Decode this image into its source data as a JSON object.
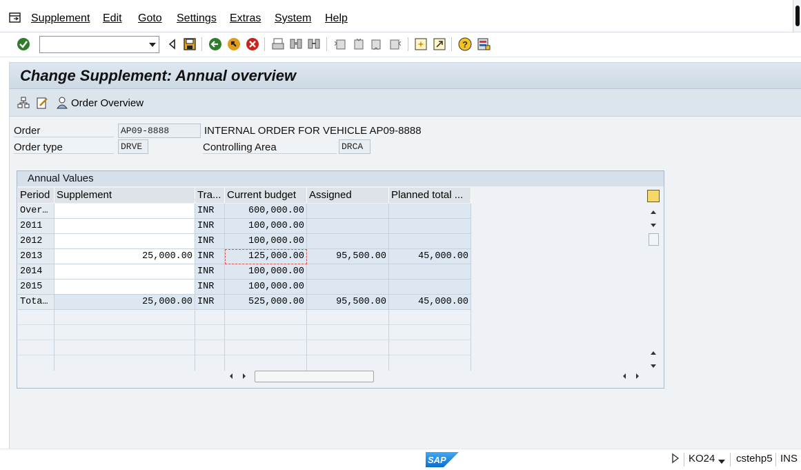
{
  "menu": {
    "items": [
      "Supplement",
      "Edit",
      "Goto",
      "Settings",
      "Extras",
      "System",
      "Help"
    ]
  },
  "toolbar": {
    "command_value": "",
    "icons": [
      "enter-icon",
      "back-icon",
      "save-icon",
      "green-back-icon",
      "exit-icon",
      "cancel-icon",
      "print-icon",
      "find-icon",
      "find-next-icon",
      "first-page-icon",
      "previous-page-icon",
      "next-page-icon",
      "last-page-icon",
      "create-session-icon",
      "shortcut-icon",
      "help-icon",
      "customize-layout-icon"
    ]
  },
  "title": "Change Supplement: Annual overview",
  "app_toolbar": {
    "order_overview_label": "Order Overview"
  },
  "header": {
    "order_label": "Order",
    "order_value": "AP09-8888",
    "order_description": "INTERNAL ORDER FOR VEHICLE AP09-8888",
    "order_type_label": "Order type",
    "order_type_value": "DRVE",
    "controlling_area_label": "Controlling Area",
    "controlling_area_value": "DRCA"
  },
  "annual_values": {
    "title": "Annual Values",
    "columns": [
      "Period",
      "Supplement",
      "Tra...",
      "Current budget",
      "Assigned",
      "Planned total ..."
    ],
    "rows": [
      [
        "Over…",
        "",
        "INR",
        "600,000.00",
        "",
        ""
      ],
      [
        "2011",
        "",
        "INR",
        "100,000.00",
        "",
        ""
      ],
      [
        "2012",
        "",
        "INR",
        "100,000.00",
        "",
        ""
      ],
      [
        "2013",
        "25,000.00",
        "INR",
        "125,000.00",
        "95,500.00",
        "45,000.00"
      ],
      [
        "2014",
        "",
        "INR",
        "100,000.00",
        "",
        ""
      ],
      [
        "2015",
        "",
        "INR",
        "100,000.00",
        "",
        ""
      ],
      [
        "Tota…",
        "25,000.00",
        "INR",
        "525,000.00",
        "95,500.00",
        "45,000.00"
      ]
    ]
  },
  "status": {
    "transaction": "KO24",
    "server": "cstehp5",
    "mode": "INS"
  }
}
